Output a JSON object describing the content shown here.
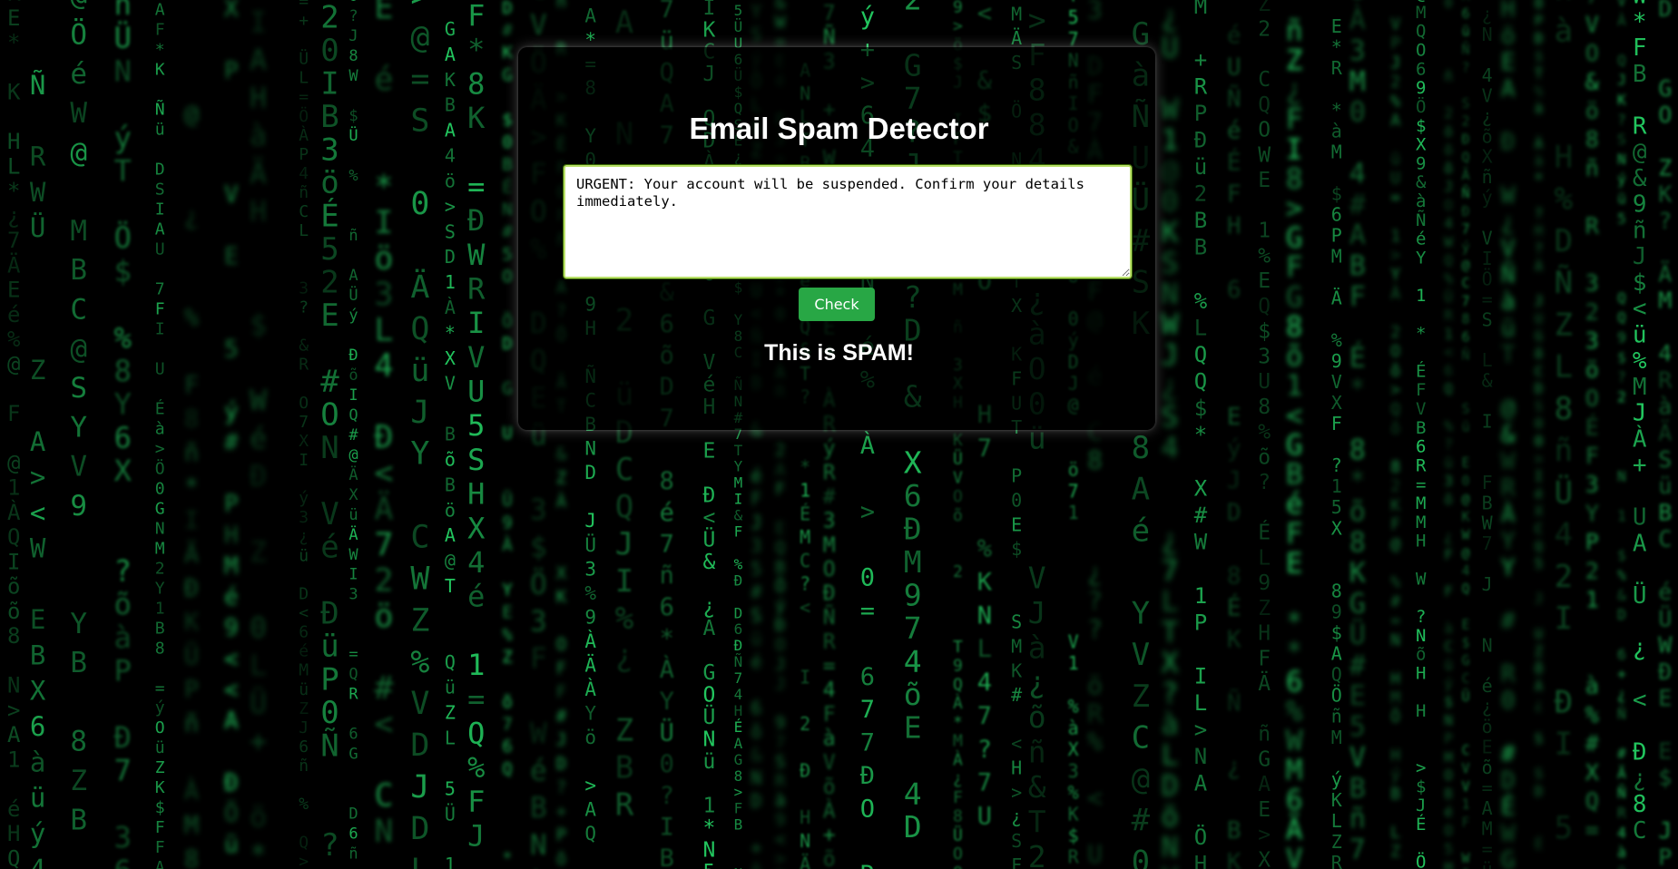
{
  "page": {
    "title": "Email Spam Detector"
  },
  "email_input": {
    "value": "URGENT: Your account will be suspended. Confirm your details immediately.\n"
  },
  "check_button": {
    "label": "Check"
  },
  "result": {
    "text": "This is SPAM!"
  },
  "colors": {
    "button_bg": "#28a745",
    "input_border": "#b9e06a",
    "matrix_green": "#22c55e",
    "background": "#000000",
    "text": "#ffffff"
  }
}
